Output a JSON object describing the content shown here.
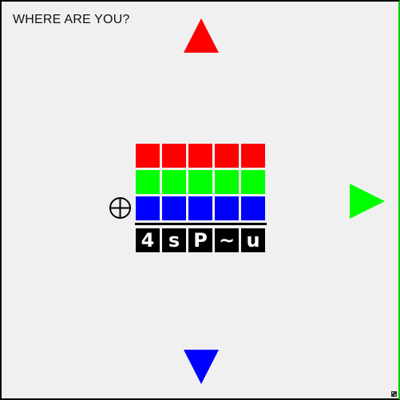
{
  "prompt": "WHERE ARE YOU?",
  "colors": {
    "red": "#ff0000",
    "green": "#00ff00",
    "blue": "#0000ff",
    "border_right": "#00cc00"
  },
  "arrows": {
    "up": {
      "icon": "triangle-up-icon",
      "color": "#ff0000"
    },
    "right": {
      "icon": "triangle-right-icon",
      "color": "#00ff00"
    },
    "down": {
      "icon": "triangle-down-icon",
      "color": "#0000ff"
    }
  },
  "grid": {
    "rows": [
      {
        "name": "red",
        "color": "#ff0000",
        "cells": 5
      },
      {
        "name": "green",
        "color": "#00ff00",
        "cells": 5
      },
      {
        "name": "blue",
        "color": "#0000ff",
        "cells": 5
      }
    ]
  },
  "crosshair_icon": "crosshair-icon",
  "code": [
    "4",
    "s",
    "P",
    "~",
    "u"
  ]
}
